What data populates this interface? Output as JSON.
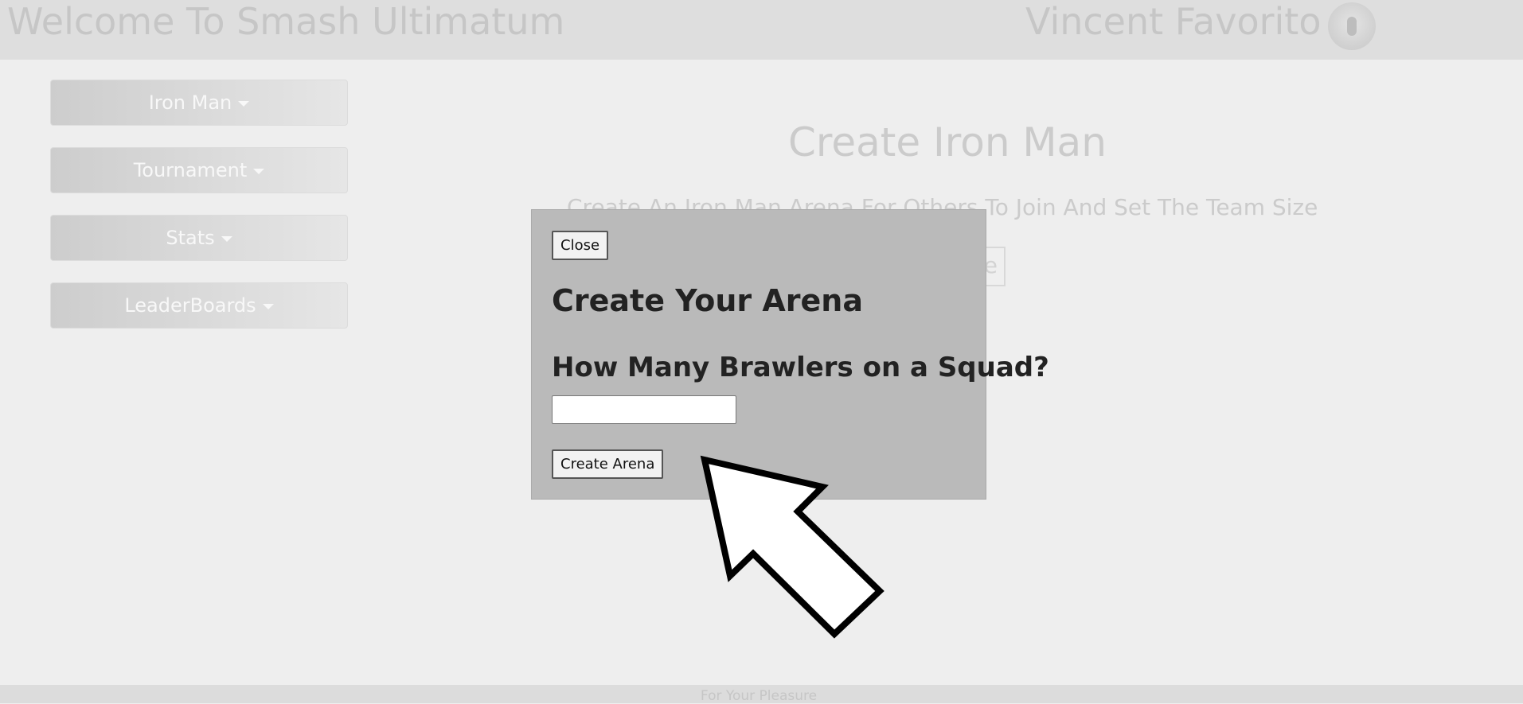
{
  "header": {
    "site_title": "Welcome To Smash Ultimatum",
    "user_name": "Vincent Favorito"
  },
  "sidebar": {
    "items": [
      {
        "label": "Iron Man"
      },
      {
        "label": "Tournament"
      },
      {
        "label": "Stats"
      },
      {
        "label": "LeaderBoards"
      }
    ]
  },
  "main": {
    "title": "Create Iron Man",
    "subtitle": "Create An Iron Man Arena For Others To Join And Set The Team Size",
    "partial_button_text": "e"
  },
  "modal": {
    "close_label": "Close",
    "title": "Create Your Arena",
    "squad_label": "How Many Brawlers on a Squad?",
    "squad_value": "",
    "create_label": "Create Arena"
  },
  "footer": {
    "text": "For Your Pleasure"
  }
}
